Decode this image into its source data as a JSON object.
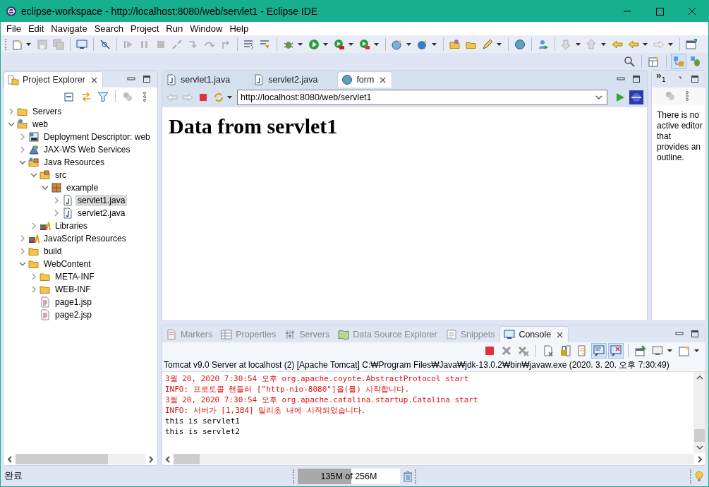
{
  "window": {
    "title": "eclipse-workspace - http://localhost:8080/web/servlet1 - Eclipse IDE"
  },
  "menu": [
    "File",
    "Edit",
    "Navigate",
    "Search",
    "Project",
    "Run",
    "Window",
    "Help"
  ],
  "project_explorer": {
    "title": "Project Explorer",
    "tree": [
      {
        "label": "Servers",
        "kind": "folder",
        "expanded": false,
        "selected": false
      },
      {
        "label": "web",
        "kind": "project",
        "expanded": true,
        "selected": false,
        "children": [
          {
            "label": "Deployment Descriptor: web",
            "kind": "descriptor",
            "expanded": false,
            "selected": false
          },
          {
            "label": "JAX-WS Web Services",
            "kind": "webservices",
            "expanded": false,
            "selected": false
          },
          {
            "label": "Java Resources",
            "kind": "javares",
            "expanded": true,
            "selected": false,
            "children": [
              {
                "label": "src",
                "kind": "srcfolder",
                "expanded": true,
                "selected": false,
                "children": [
                  {
                    "label": "example",
                    "kind": "package",
                    "expanded": true,
                    "selected": false,
                    "children": [
                      {
                        "label": "servlet1.java",
                        "kind": "java",
                        "expanded": false,
                        "selected": true
                      },
                      {
                        "label": "servlet2.java",
                        "kind": "java",
                        "expanded": false,
                        "selected": false
                      }
                    ]
                  }
                ]
              },
              {
                "label": "Libraries",
                "kind": "library",
                "expanded": false,
                "selected": false
              }
            ]
          },
          {
            "label": "JavaScript Resources",
            "kind": "library",
            "expanded": false,
            "selected": false
          },
          {
            "label": "build",
            "kind": "folder",
            "expanded": false,
            "selected": false
          },
          {
            "label": "WebContent",
            "kind": "folder",
            "expanded": true,
            "selected": false,
            "children": [
              {
                "label": "META-INF",
                "kind": "folder",
                "expanded": false,
                "selected": false
              },
              {
                "label": "WEB-INF",
                "kind": "folder",
                "expanded": false,
                "selected": false
              },
              {
                "label": "page1.jsp",
                "kind": "file",
                "selected": false
              },
              {
                "label": "page2.jsp",
                "kind": "file",
                "selected": false
              }
            ]
          }
        ]
      }
    ]
  },
  "editor": {
    "tabs": [
      {
        "label": "servlet1.java",
        "kind": "java",
        "selected": false
      },
      {
        "label": "servlet2.java",
        "kind": "java",
        "selected": false
      },
      {
        "label": "form",
        "kind": "browser",
        "selected": true
      }
    ],
    "url": "http://localhost:8080/web/servlet1",
    "heading": "Data from servlet1"
  },
  "outline": {
    "tab_label": "1",
    "message": "There is no active editor that provides an outline."
  },
  "bottom_panel": {
    "tabs": [
      {
        "label": "Markers",
        "kind": "markers",
        "selected": false
      },
      {
        "label": "Properties",
        "kind": "properties",
        "selected": false
      },
      {
        "label": "Servers",
        "kind": "servers",
        "selected": false
      },
      {
        "label": "Data Source Explorer",
        "kind": "datasource",
        "selected": false
      },
      {
        "label": "Snippets",
        "kind": "snippets",
        "selected": false
      },
      {
        "label": "Console",
        "kind": "console",
        "selected": true
      }
    ],
    "console_title": "Tomcat v9.0 Server at localhost (2) [Apache Tomcat] C:₩Program Files₩Java₩jdk-13.0.2₩bin₩javaw.exe (2020. 3. 20. 오후 7:30:49)",
    "lines": [
      {
        "text": "3월 20, 2020 7:30:54 오후 org.apache.coyote.AbstractProtocol start",
        "kind": "stderr"
      },
      {
        "text": "INFO: 프로토콜 핸들러 [\"http-nio-8080\"]을(를) 시작합니다.",
        "kind": "stderr"
      },
      {
        "text": "3월 20, 2020 7:30:54 오후 org.apache.catalina.startup.Catalina start",
        "kind": "stderr"
      },
      {
        "text": "INFO: 서버가 [1,384] 밀리초 내에 시작되었습니다.",
        "kind": "stderr"
      },
      {
        "text": "this is servlet1",
        "kind": "stdout"
      },
      {
        "text": "this is servlet2",
        "kind": "stdout"
      }
    ]
  },
  "status_bar": {
    "message": "완료",
    "memory": {
      "text": "135M of 256M",
      "level": 0.527
    }
  }
}
